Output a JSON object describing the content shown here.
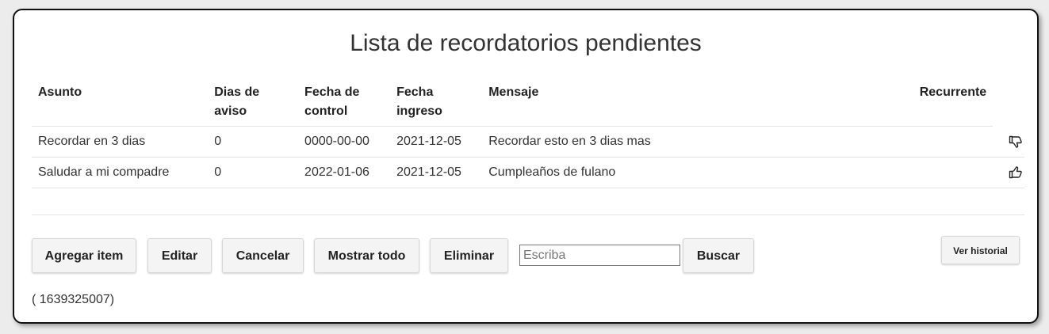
{
  "title": "Lista de recordatorios pendientes",
  "table": {
    "headers": {
      "asunto": "Asunto",
      "dias_line1": "Dias de",
      "dias_line2": "aviso",
      "control_line1": "Fecha de",
      "control_line2": "control",
      "ingreso_line1": "Fecha",
      "ingreso_line2": "ingreso",
      "mensaje": "Mensaje",
      "recurrente": "Recurrente"
    },
    "rows": [
      {
        "asunto": "Recordar en 3 dias",
        "dias": "0",
        "fecha_control": "0000-00-00",
        "fecha_ingreso": "2021-12-05",
        "mensaje": "Recordar esto en 3 dias mas",
        "recurrente_icon": "thumbs-down-icon"
      },
      {
        "asunto": "Saludar a mi compadre",
        "dias": "0",
        "fecha_control": "2022-01-06",
        "fecha_ingreso": "2021-12-05",
        "mensaje": "Cumpleaños de fulano",
        "recurrente_icon": "thumbs-up-icon"
      }
    ]
  },
  "toolbar": {
    "agregar": "Agregar item",
    "editar": "Editar",
    "cancelar": "Cancelar",
    "mostrar": "Mostrar todo",
    "eliminar": "Eliminar",
    "search_placeholder": "Escriba",
    "buscar": "Buscar",
    "historial": "Ver historial"
  },
  "footer": {
    "id_text": "( 1639325007)"
  }
}
